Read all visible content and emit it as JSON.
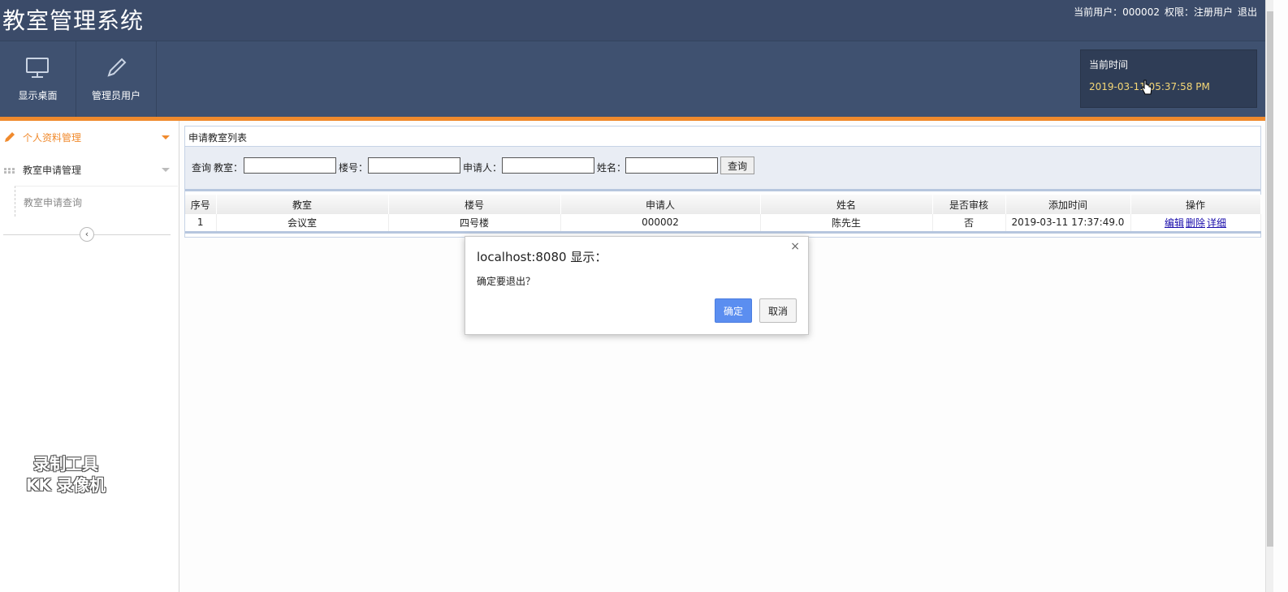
{
  "header": {
    "app_title": "教室管理系统",
    "current_user": "当前用户：000002",
    "permission": "权限：注册用户",
    "logout": "退出"
  },
  "nav": {
    "desktop": "显示桌面",
    "admin_user": "管理员用户"
  },
  "clock": {
    "label": "当前时间",
    "value": "2019-03-11 05:37:58 PM"
  },
  "sidebar": {
    "item_profile": "个人资料管理",
    "item_apply": "教室申请管理",
    "sub_query": "教室申请查询",
    "collapse": "‹"
  },
  "panel": {
    "title": "申请教室列表",
    "search": {
      "prefix": "查询",
      "classroom_label": "教室：",
      "classroom_value": "",
      "building_label": "楼号：",
      "building_value": "",
      "applicant_label": "申请人：",
      "applicant_value": "",
      "name_label": "姓名：",
      "name_value": "",
      "button": "查询"
    },
    "table": {
      "headers": [
        "序号",
        "教室",
        "楼号",
        "申请人",
        "姓名",
        "是否审核",
        "添加时间",
        "操作"
      ],
      "rows": [
        {
          "index": "1",
          "classroom": "会议室",
          "building": "四号楼",
          "applicant": "000002",
          "name": "陈先生",
          "approved": "否",
          "added_time": "2019-03-11 17:37:49.0",
          "edit": "编辑",
          "delete": "删除",
          "detail": "详细"
        }
      ]
    }
  },
  "dialog": {
    "title": "localhost:8080 显示：",
    "close": "×",
    "message": "确定要退出？",
    "ok": "确定",
    "cancel": "取消"
  },
  "watermark": {
    "line1": "录制工具",
    "line2": "KK 录像机"
  },
  "colors": {
    "header_bg": "#3b4b69",
    "accent": "#f08a2d",
    "clock_text": "#f5d776",
    "ok_button": "#5b8ef0"
  }
}
